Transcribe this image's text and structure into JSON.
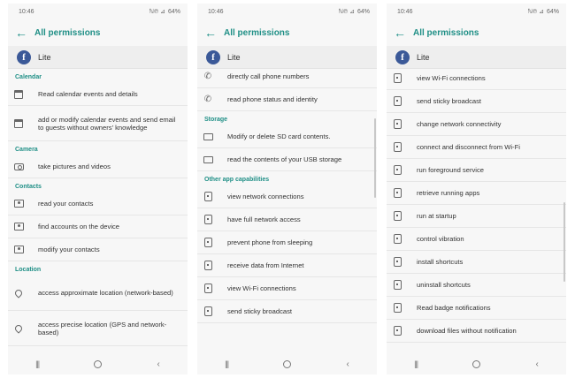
{
  "status_bar": {
    "time": "10:46",
    "signal": "ℕ℗ ⊿",
    "battery": "64%"
  },
  "app_bar": {
    "title": "All permissions",
    "back_icon": "arrow-left-icon"
  },
  "app": {
    "name": "Lite",
    "icon": "facebook-icon"
  },
  "nav": {
    "recent": "|||",
    "home": "home-icon",
    "back": "‹"
  },
  "accent_color": "#1f8f86",
  "screens": [
    {
      "partial_top": "",
      "rows": [
        {
          "type": "section",
          "label": "Calendar"
        },
        {
          "type": "item",
          "icon": "calendar-icon",
          "label": "Read calendar events and details"
        },
        {
          "type": "item",
          "icon": "calendar-icon",
          "label": "add or modify calendar events and send email to guests without owners' knowledge",
          "tall": true
        },
        {
          "type": "section",
          "label": "Camera"
        },
        {
          "type": "item",
          "icon": "camera-icon",
          "label": "take pictures and videos"
        },
        {
          "type": "section",
          "label": "Contacts"
        },
        {
          "type": "item",
          "icon": "contact-icon",
          "label": "read your contacts"
        },
        {
          "type": "item",
          "icon": "contact-icon",
          "label": "find accounts on the device"
        },
        {
          "type": "item",
          "icon": "contact-icon",
          "label": "modify your contacts"
        },
        {
          "type": "section",
          "label": "Location"
        },
        {
          "type": "item",
          "icon": "location-icon",
          "label": "access approximate location (network-based)",
          "tall": true
        },
        {
          "type": "item",
          "icon": "location-icon",
          "label": "access precise location (GPS and network-based)",
          "tall": true
        }
      ]
    },
    {
      "partial_top": "Phone",
      "rows": [
        {
          "type": "item",
          "icon": "phone-call-icon",
          "label": "directly call phone numbers"
        },
        {
          "type": "item",
          "icon": "phone-call-icon",
          "label": "read phone status and identity"
        },
        {
          "type": "section",
          "label": "Storage"
        },
        {
          "type": "item",
          "icon": "folder-icon",
          "label": "Modify or delete SD card contents."
        },
        {
          "type": "item",
          "icon": "folder-icon",
          "label": "read the contents of your USB storage"
        },
        {
          "type": "section",
          "label": "Other app capabilities"
        },
        {
          "type": "item",
          "icon": "phone-icon",
          "label": "view network connections"
        },
        {
          "type": "item",
          "icon": "phone-icon",
          "label": "have full network access"
        },
        {
          "type": "item",
          "icon": "phone-icon",
          "label": "prevent phone from sleeping"
        },
        {
          "type": "item",
          "icon": "phone-icon",
          "label": "receive data from Internet"
        },
        {
          "type": "item",
          "icon": "phone-icon",
          "label": "view Wi-Fi connections"
        },
        {
          "type": "item",
          "icon": "phone-icon",
          "label": "send sticky broadcast"
        }
      ]
    },
    {
      "partial_top": "",
      "rows": [
        {
          "type": "item",
          "icon": "phone-icon",
          "label": "view Wi-Fi connections"
        },
        {
          "type": "item",
          "icon": "phone-icon",
          "label": "send sticky broadcast"
        },
        {
          "type": "item",
          "icon": "phone-icon",
          "label": "change network connectivity"
        },
        {
          "type": "item",
          "icon": "phone-icon",
          "label": "connect and disconnect from Wi-Fi"
        },
        {
          "type": "item",
          "icon": "phone-icon",
          "label": "run foreground service"
        },
        {
          "type": "item",
          "icon": "phone-icon",
          "label": "retrieve running apps"
        },
        {
          "type": "item",
          "icon": "phone-icon",
          "label": "run at startup"
        },
        {
          "type": "item",
          "icon": "phone-icon",
          "label": "control vibration"
        },
        {
          "type": "item",
          "icon": "phone-icon",
          "label": "install shortcuts"
        },
        {
          "type": "item",
          "icon": "phone-icon",
          "label": "uninstall shortcuts"
        },
        {
          "type": "item",
          "icon": "phone-icon",
          "label": "Read badge notifications"
        },
        {
          "type": "item",
          "icon": "phone-icon",
          "label": "download files without notification"
        }
      ]
    }
  ]
}
